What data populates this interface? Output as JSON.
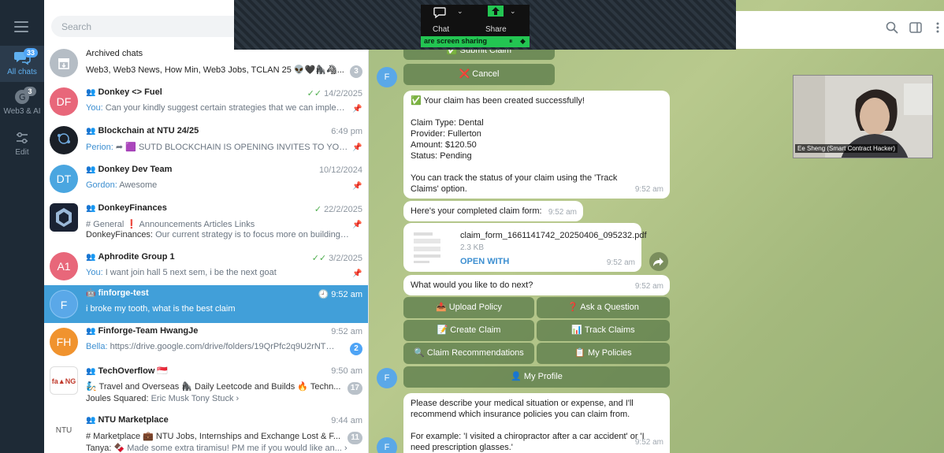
{
  "rail": {
    "items": [
      {
        "label": "All chats",
        "badge": "33"
      },
      {
        "label": "Web3 & AI",
        "badge": "3"
      },
      {
        "label": "Edit"
      }
    ]
  },
  "search": {
    "placeholder": "Search"
  },
  "chats": [
    {
      "name": "Archived chats",
      "line1": "Web3, Web3 News, How Min, Web3 Jobs, TCLAN 25 👽🖤🦍🦓...",
      "badge": "3"
    },
    {
      "initials": "DF",
      "name": "Donkey <> Fuel",
      "time": "14/2/2025",
      "sender": "You:",
      "preview": "Can your kindly suggest certain strategies that we can impleme..."
    },
    {
      "name": "Blockchain at NTU 24/25",
      "time": "6:49 pm",
      "sender": "Perion:",
      "preview": "➦ 🟪 SUTD BLOCKCHAIN IS OPENING INVITES TO YOU!! 📣"
    },
    {
      "initials": "DT",
      "name": "Donkey Dev Team",
      "time": "10/12/2024",
      "sender": "Gordon:",
      "preview": "Awesome"
    },
    {
      "name": "DonkeyFinances",
      "time": "22/2/2025",
      "line1": "# General  ❗ Announcements  Articles  Links",
      "sender": "DonkeyFinances:",
      "preview": "Our current strategy is to focus more on building t..."
    },
    {
      "initials": "A1",
      "name": "Aphrodite Group 1",
      "time": "3/2/2025",
      "sender": "You:",
      "preview": "I want join hall 5 next sem, i be the next goat"
    },
    {
      "initials": "F",
      "name": "finforge-test",
      "time": "9:52 am",
      "preview": "i broke my tooth, what is the best claim"
    },
    {
      "initials": "FH",
      "name": "Finforge-Team HwangJe",
      "time": "9:52 am",
      "sender": "Bella:",
      "preview": "https://drive.google.com/drive/folders/19QrPfc2q9U2rNTNXhk...",
      "badge": "2"
    },
    {
      "name": "TechOverflow 🇸🇬",
      "time": "9:50 am",
      "line1": "🧞 Travel and Overseas  🦍 Daily Leetcode and Builds  🔥 Techn...",
      "sender": "Joules Squared:",
      "preview": "Eric Musk Tony Stuck ›",
      "badge": "17"
    },
    {
      "initials": "NTU",
      "name": "NTU Marketplace",
      "time": "9:44 am",
      "line1": "# Marketplace  💼 NTU Jobs, Internships and Exchange  Lost & F...",
      "sender": "Tanya:",
      "preview": "🍫 Made some extra tiramisu! PM me if you would like an... ›",
      "badge": "11"
    }
  ],
  "share": {
    "chat": "Chat",
    "share": "Share",
    "status": "are screen sharing"
  },
  "messages": {
    "submit_claim": "✅ Submit Claim",
    "cancel": "❌ Cancel",
    "created": {
      "title": "✅ Your claim has been created successfully!",
      "type": "Claim Type: Dental",
      "provider": "Provider: Fullerton",
      "amount": "Amount: $120.50",
      "status": "Status: Pending",
      "track": "You can track the status of your claim using the 'Track Claims' option.",
      "time": "9:52 am"
    },
    "completed": {
      "text": "Here's your completed claim form:",
      "time": "9:52 am"
    },
    "file": {
      "name": "claim_form_1661141742_20250406_095232.pdf",
      "size": "2.3 KB",
      "open": "OPEN WITH",
      "time": "9:52 am"
    },
    "next": {
      "text": "What would you like to do next?",
      "time": "9:52 am"
    },
    "buttons": [
      "📤 Upload Policy",
      "❓ Ask a Question",
      "📝 Create Claim",
      "📊 Track Claims",
      "🔍 Claim Recommendations",
      "📋 My Policies",
      "👤 My Profile"
    ],
    "describe": {
      "p1": "Please describe your medical situation or expense, and I'll recommend which insurance policies you can claim from.",
      "p2": "For example: 'I visited a chiropractor after a car accident' or 'I need prescription glasses.'",
      "time": "9:52 am"
    },
    "avatar": "F"
  },
  "webcam": {
    "label": "Ee Sheng (Smart Contract Hacker)"
  }
}
